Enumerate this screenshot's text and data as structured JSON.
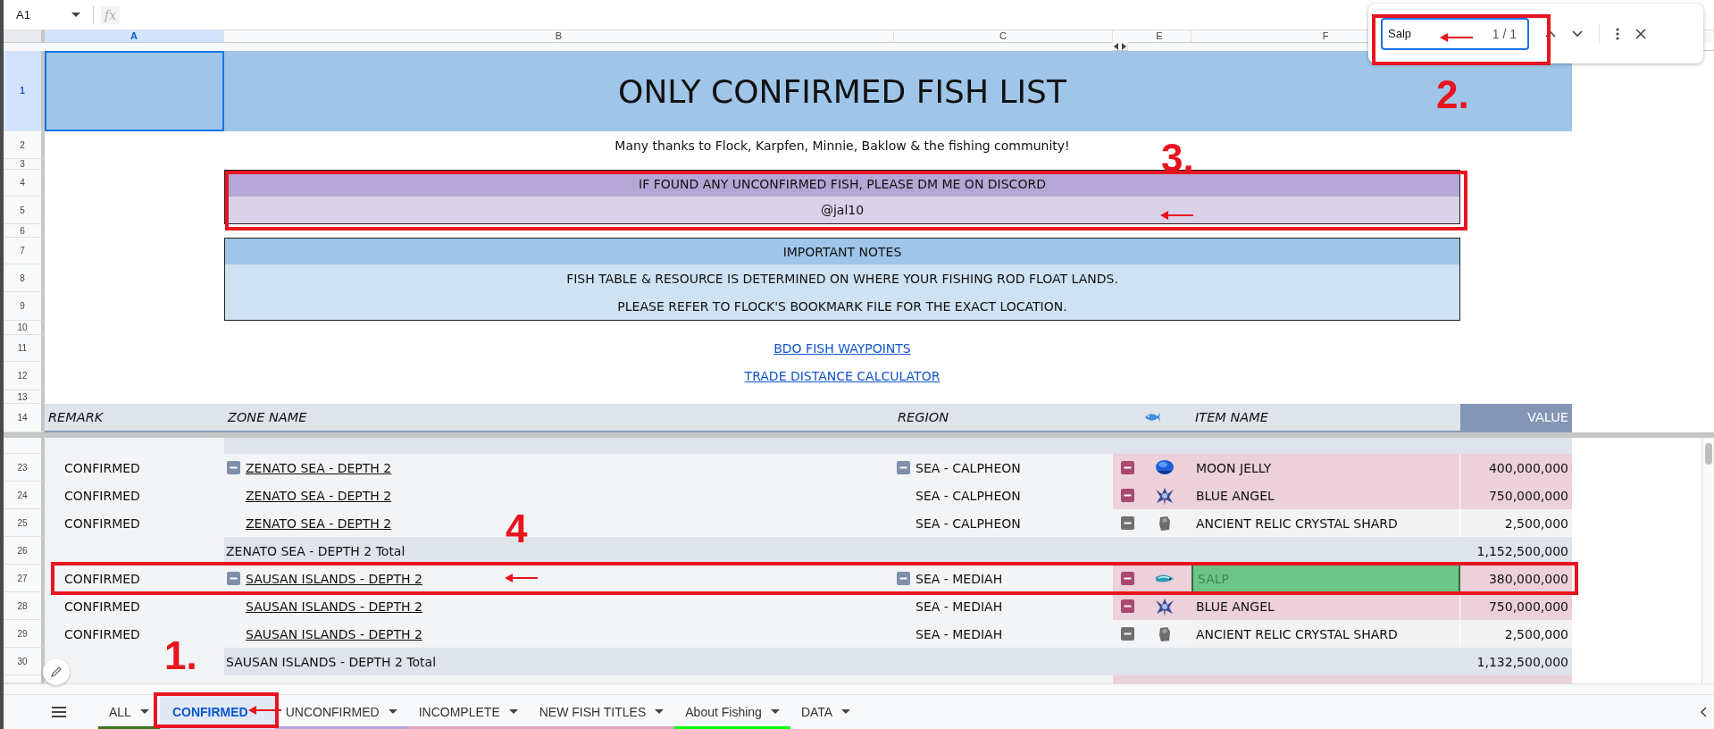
{
  "name_box": "A1",
  "formula_label": "fx",
  "columns": [
    {
      "label": "A",
      "selected": true
    },
    {
      "label": "B",
      "selected": false
    },
    {
      "label": "C",
      "selected": false
    },
    {
      "label": "E",
      "selected": false
    },
    {
      "label": "F",
      "selected": false
    }
  ],
  "row_numbers": [
    {
      "label": "1",
      "selected": true
    },
    {
      "label": "2",
      "selected": false
    },
    {
      "label": "3",
      "selected": false
    },
    {
      "label": "4",
      "selected": false
    },
    {
      "label": "5",
      "selected": false
    },
    {
      "label": "6",
      "selected": false
    },
    {
      "label": "7",
      "selected": false
    },
    {
      "label": "8",
      "selected": false
    },
    {
      "label": "9",
      "selected": false
    },
    {
      "label": "10",
      "selected": false
    },
    {
      "label": "11",
      "selected": false
    },
    {
      "label": "12",
      "selected": false
    },
    {
      "label": "13",
      "selected": false
    },
    {
      "label": "14",
      "selected": false
    }
  ],
  "title": "ONLY CONFIRMED FISH LIST",
  "thanks": "Many thanks to Flock, Karpfen, Minnie, Baklow & the fishing community!",
  "contact": {
    "heading": "IF FOUND ANY UNCONFIRMED FISH, PLEASE DM ME ON DISCORD",
    "handle": "@jal10"
  },
  "notes": {
    "heading": "IMPORTANT NOTES",
    "lines": [
      "FISH TABLE & RESOURCE IS DETERMINED ON WHERE YOUR FISHING ROD FLOAT LANDS.",
      "PLEASE REFER TO FLOCK'S BOOKMARK FILE FOR THE EXACT LOCATION."
    ]
  },
  "links": [
    "BDO FISH WAYPOINTS",
    "TRADE DISTANCE CALCULATOR"
  ],
  "table": {
    "header": {
      "remark": "REMARK",
      "zone": "ZONE NAME",
      "region": "REGION",
      "item": "ITEM NAME",
      "value": "VALUE"
    },
    "rows": [
      {
        "kind": "jellyfish",
        "number": "23",
        "remark": "CONFIRMED",
        "zone": "ZENATO SEA - DEPTH 2",
        "zone_toggle": true,
        "region": "SEA - CALPHEON",
        "region_toggle": true,
        "highlighted": true,
        "item": "MOON JELLY",
        "value": "400,000,000",
        "match": false
      },
      {
        "kind": "angel",
        "number": "24",
        "remark": "CONFIRMED",
        "zone": "ZENATO SEA - DEPTH 2",
        "zone_toggle": false,
        "region": "SEA - CALPHEON",
        "region_toggle": false,
        "highlighted": true,
        "item": "BLUE ANGEL",
        "value": "750,000,000",
        "match": false
      },
      {
        "kind": "shard",
        "number": "25",
        "remark": "CONFIRMED",
        "zone": "ZENATO SEA - DEPTH 2",
        "zone_toggle": false,
        "region": "SEA - CALPHEON",
        "region_toggle": false,
        "highlighted": false,
        "item": "ANCIENT RELIC CRYSTAL SHARD",
        "value": "2,500,000",
        "match": false
      },
      {
        "kind": "total",
        "number": "26",
        "label": "ZENATO SEA - DEPTH 2 Total",
        "value": "1,152,500,000"
      },
      {
        "kind": "salp",
        "number": "27",
        "remark": "CONFIRMED",
        "zone": "SAUSAN ISLANDS - DEPTH 2",
        "zone_toggle": true,
        "region": "SEA - MEDIAH",
        "region_toggle": true,
        "highlighted": true,
        "item": "SALP",
        "value": "380,000,000",
        "match": true
      },
      {
        "kind": "angel",
        "number": "28",
        "remark": "CONFIRMED",
        "zone": "SAUSAN ISLANDS - DEPTH 2",
        "zone_toggle": false,
        "region": "SEA - MEDIAH",
        "region_toggle": false,
        "highlighted": true,
        "item": "BLUE ANGEL",
        "value": "750,000,000",
        "match": false
      },
      {
        "kind": "shard",
        "number": "29",
        "remark": "CONFIRMED",
        "zone": "SAUSAN ISLANDS - DEPTH 2",
        "zone_toggle": false,
        "region": "SEA - MEDIAH",
        "region_toggle": false,
        "highlighted": false,
        "item": "ANCIENT RELIC CRYSTAL SHARD",
        "value": "2,500,000",
        "match": false
      },
      {
        "kind": "total",
        "number": "30",
        "label": "SAUSAN ISLANDS - DEPTH 2 Total",
        "value": "1,132,500,000"
      }
    ]
  },
  "find": {
    "query": "Salp",
    "count": "1 / 1"
  },
  "tabs": [
    {
      "label": "ALL",
      "selected": false,
      "color": "#38761d"
    },
    {
      "label": "CONFIRMED",
      "selected": true
    },
    {
      "label": "UNCONFIRMED",
      "selected": false,
      "color": "#b4a7d6"
    },
    {
      "label": "INCOMPLETE",
      "selected": false,
      "color": "#d5a6bd"
    },
    {
      "label": "NEW FISH TITLES",
      "selected": false,
      "color": "#d5a6bd"
    },
    {
      "label": "About Fishing",
      "selected": false,
      "color": "#00ff00"
    },
    {
      "label": "DATA",
      "selected": false
    }
  ],
  "annotations": {
    "steps": [
      "2.",
      "3.",
      "4",
      "1."
    ]
  }
}
